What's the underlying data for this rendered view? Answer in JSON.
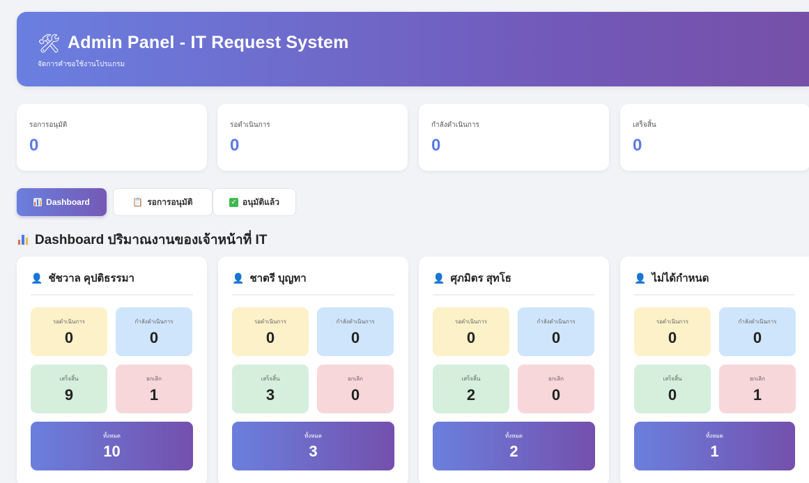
{
  "header": {
    "icon": "tools-icon",
    "title": "Admin Panel - IT Request System",
    "subtitle": "จัดการคำขอใช้งานโปรแกรม"
  },
  "stats": [
    {
      "label": "รอการอนุมัติ",
      "value": "0"
    },
    {
      "label": "รอดำเนินการ",
      "value": "0"
    },
    {
      "label": "กำลังดำเนินการ",
      "value": "0"
    },
    {
      "label": "เสร็จสิ้น",
      "value": "0"
    }
  ],
  "tabs": [
    {
      "label": "Dashboard",
      "icon": "bar-chart-icon",
      "active": true
    },
    {
      "label": "รอการอนุมัติ",
      "icon": "clipboard-icon",
      "active": false
    },
    {
      "label": "อนุมัติแล้ว",
      "icon": "check-box-icon",
      "active": false
    }
  ],
  "section_title": "Dashboard ปริมาณงานของเจ้าหน้าที่ IT",
  "labels": {
    "pending": "รอดำเนินการ",
    "in_progress": "กำลังดำเนินการ",
    "done": "เสร็จสิ้น",
    "cancelled": "ยกเลิก",
    "total": "ทั้งหมด"
  },
  "staff": [
    {
      "name": "ชัชวาล คุปติธรรมา",
      "pending": "0",
      "in_progress": "0",
      "done": "9",
      "cancelled": "1",
      "total": "10"
    },
    {
      "name": "ชาตรี บุญทา",
      "pending": "0",
      "in_progress": "0",
      "done": "3",
      "cancelled": "0",
      "total": "3"
    },
    {
      "name": "ศุภมิตร สุทโธ",
      "pending": "0",
      "in_progress": "0",
      "done": "2",
      "cancelled": "0",
      "total": "2"
    },
    {
      "name": "ไม่ได้กำหนด",
      "pending": "0",
      "in_progress": "0",
      "done": "0",
      "cancelled": "1",
      "total": "1"
    }
  ],
  "colors": {
    "accent_start": "#6b7fdd",
    "accent_end": "#7450ad",
    "stat_value": "#5b7be3",
    "pending_bg": "#fdf1c9",
    "in_progress_bg": "#cfe5fb",
    "done_bg": "#d5efdc",
    "cancelled_bg": "#f8d7db"
  }
}
